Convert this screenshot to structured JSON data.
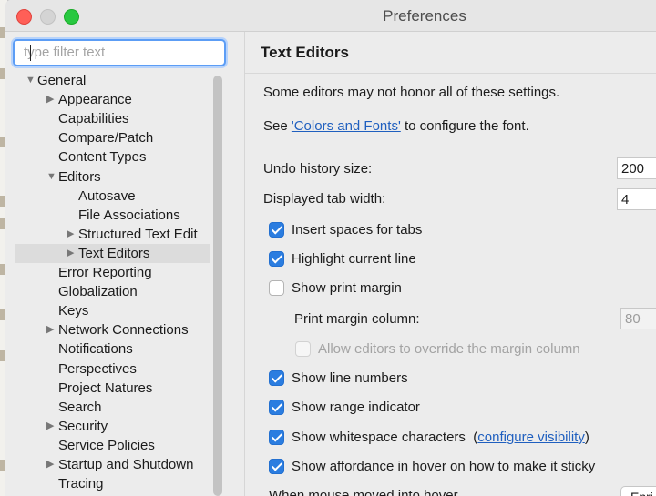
{
  "window": {
    "title": "Preferences"
  },
  "filter": {
    "placeholder": "type filter text",
    "value": ""
  },
  "tree": [
    {
      "label": "General",
      "depth": 0,
      "twisty": "expanded"
    },
    {
      "label": "Appearance",
      "depth": 1,
      "twisty": "collapsed"
    },
    {
      "label": "Capabilities",
      "depth": 1,
      "twisty": "none"
    },
    {
      "label": "Compare/Patch",
      "depth": 1,
      "twisty": "none"
    },
    {
      "label": "Content Types",
      "depth": 1,
      "twisty": "none"
    },
    {
      "label": "Editors",
      "depth": 1,
      "twisty": "expanded"
    },
    {
      "label": "Autosave",
      "depth": 2,
      "twisty": "none"
    },
    {
      "label": "File Associations",
      "depth": 2,
      "twisty": "none"
    },
    {
      "label": "Structured Text Edit",
      "depth": 2,
      "twisty": "collapsed"
    },
    {
      "label": "Text Editors",
      "depth": 2,
      "twisty": "collapsed",
      "selected": true
    },
    {
      "label": "Error Reporting",
      "depth": 1,
      "twisty": "none"
    },
    {
      "label": "Globalization",
      "depth": 1,
      "twisty": "none"
    },
    {
      "label": "Keys",
      "depth": 1,
      "twisty": "none"
    },
    {
      "label": "Network Connections",
      "depth": 1,
      "twisty": "collapsed"
    },
    {
      "label": "Notifications",
      "depth": 1,
      "twisty": "none"
    },
    {
      "label": "Perspectives",
      "depth": 1,
      "twisty": "none"
    },
    {
      "label": "Project Natures",
      "depth": 1,
      "twisty": "none"
    },
    {
      "label": "Search",
      "depth": 1,
      "twisty": "none"
    },
    {
      "label": "Security",
      "depth": 1,
      "twisty": "collapsed"
    },
    {
      "label": "Service Policies",
      "depth": 1,
      "twisty": "none"
    },
    {
      "label": "Startup and Shutdown",
      "depth": 1,
      "twisty": "collapsed"
    },
    {
      "label": "Tracing",
      "depth": 1,
      "twisty": "none"
    }
  ],
  "page": {
    "title": "Text Editors",
    "note": "Some editors may not honor all of these settings.",
    "see_prefix": "See ",
    "see_link": "'Colors and Fonts'",
    "see_suffix": " to configure the font.",
    "undo_label": "Undo history size:",
    "undo_value": "200",
    "tab_label": "Displayed tab width:",
    "tab_value": "4",
    "insert_spaces": {
      "label": "Insert spaces for tabs",
      "checked": true
    },
    "highlight_line": {
      "label": "Highlight current line",
      "checked": true
    },
    "print_margin": {
      "label": "Show print margin",
      "checked": false
    },
    "margin_col_label": "Print margin column:",
    "margin_col_value": "80",
    "allow_override": {
      "label": "Allow editors to override the margin column",
      "checked": false,
      "disabled": true
    },
    "line_numbers": {
      "label": "Show line numbers",
      "checked": true
    },
    "range_indicator": {
      "label": "Show range indicator",
      "checked": true
    },
    "whitespace": {
      "label": "Show whitespace characters",
      "checked": true,
      "paren_open": "(",
      "link": "configure visibility",
      "paren_close": ")"
    },
    "affordance": {
      "label": "Show affordance in hover on how to make it sticky",
      "checked": true
    },
    "cut_label": "When mouse moved into hover",
    "cut_button": "Enri"
  }
}
